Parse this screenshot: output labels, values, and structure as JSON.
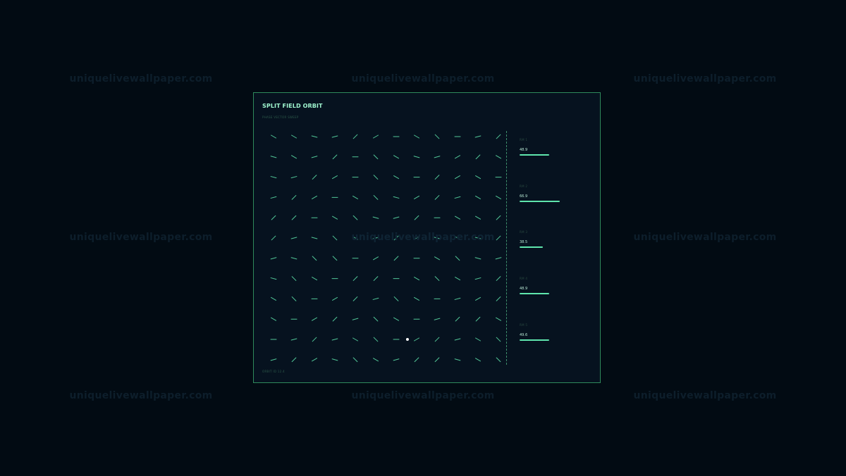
{
  "watermark": "uniquelivewallpaper.com",
  "panel": {
    "title": "SPLIT FIELD ORBIT",
    "subtitle": "PHASE VECTOR SWEEP",
    "footer": "ORBIT ID 12.4"
  },
  "metrics": [
    {
      "label": "RM 1",
      "value": "48.9",
      "fraction": 0.489
    },
    {
      "label": "RM 2",
      "value": "66.9",
      "fraction": 0.669
    },
    {
      "label": "RM 3",
      "value": "38.5",
      "fraction": 0.385
    },
    {
      "label": "RM 4",
      "value": "48.9",
      "fraction": 0.489
    },
    {
      "label": "RM 5",
      "value": "49.6",
      "fraction": 0.496
    }
  ],
  "field": {
    "rows": 12,
    "cols": 12,
    "angles": [
      [
        30,
        30,
        15,
        -15,
        -45,
        -30,
        0,
        30,
        45,
        0,
        -15,
        -45
      ],
      [
        15,
        30,
        -15,
        -45,
        0,
        45,
        30,
        15,
        -15,
        -30,
        -45,
        30
      ],
      [
        15,
        -15,
        -45,
        -30,
        0,
        45,
        30,
        0,
        -45,
        -30,
        30,
        0
      ],
      [
        -15,
        -45,
        -30,
        0,
        30,
        45,
        15,
        -30,
        -45,
        -15,
        30,
        30
      ],
      [
        -45,
        -45,
        0,
        30,
        45,
        15,
        -15,
        -45,
        0,
        30,
        30,
        -45
      ],
      [
        -45,
        -15,
        15,
        45,
        30,
        -15,
        -45,
        -30,
        15,
        30,
        15,
        -45
      ],
      [
        -15,
        15,
        45,
        45,
        0,
        -30,
        -45,
        0,
        30,
        45,
        15,
        -15
      ],
      [
        15,
        45,
        30,
        0,
        -45,
        -45,
        0,
        30,
        45,
        30,
        -15,
        -45
      ],
      [
        30,
        45,
        0,
        -30,
        -45,
        -15,
        45,
        30,
        0,
        -15,
        -30,
        -45
      ],
      [
        30,
        0,
        -30,
        -45,
        -15,
        45,
        30,
        0,
        -15,
        -45,
        -45,
        30
      ],
      [
        0,
        -15,
        -45,
        -15,
        30,
        45,
        0,
        -30,
        -45,
        -15,
        30,
        45
      ],
      [
        -15,
        -45,
        -30,
        15,
        45,
        30,
        -15,
        -45,
        -45,
        15,
        30,
        45
      ]
    ],
    "marker": {
      "row": 10,
      "col": 6.55
    }
  },
  "colors": {
    "accent": "#5fe6ad",
    "panel_border": "#2f8a5c",
    "panel_bg": "#06121f",
    "background": "#020b13",
    "marker": "#ffffff"
  }
}
